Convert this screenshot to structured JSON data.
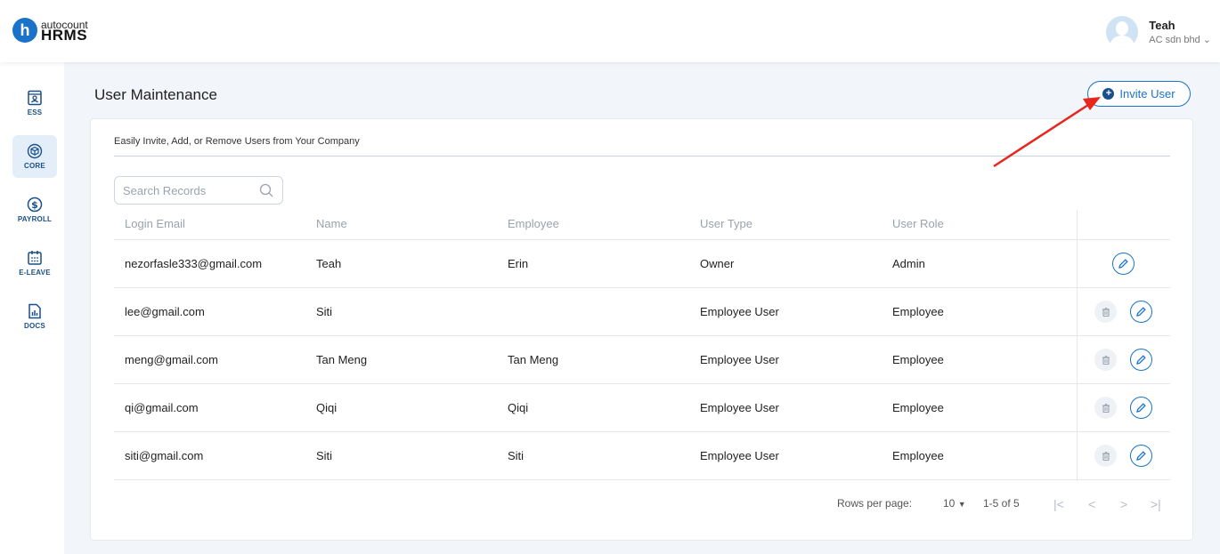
{
  "app": {
    "logo_letter": "h",
    "logo_small": "autocount",
    "logo_big": "HRMS"
  },
  "user": {
    "name": "Teah",
    "company": "AC sdn bhd ⌄"
  },
  "sidebar": {
    "items": [
      {
        "label": "ESS",
        "icon": "ess-icon"
      },
      {
        "label": "CORE",
        "icon": "cube-icon",
        "active": true
      },
      {
        "label": "PAYROLL",
        "icon": "dollar-icon"
      },
      {
        "label": "E-LEAVE",
        "icon": "calendar-icon"
      },
      {
        "label": "DOCS",
        "icon": "document-chart-icon"
      }
    ]
  },
  "page": {
    "title": "User Maintenance",
    "invite_label": "Invite User",
    "description": "Easily Invite, Add, or Remove Users from Your Company"
  },
  "search": {
    "placeholder": "Search Records"
  },
  "table": {
    "headers": [
      "Login Email",
      "Name",
      "Employee",
      "User Type",
      "User Role"
    ],
    "rows": [
      {
        "email": "nezorfasle333@gmail.com",
        "name": "Teah",
        "employee": "Erin",
        "type": "Owner",
        "role": "Admin",
        "deletable": false
      },
      {
        "email": "lee@gmail.com",
        "name": "Siti",
        "employee": "",
        "type": "Employee User",
        "role": "Employee",
        "deletable": true
      },
      {
        "email": "meng@gmail.com",
        "name": "Tan Meng",
        "employee": "Tan Meng",
        "type": "Employee User",
        "role": "Employee",
        "deletable": true
      },
      {
        "email": "qi@gmail.com",
        "name": "Qiqi",
        "employee": "Qiqi",
        "type": "Employee User",
        "role": "Employee",
        "deletable": true
      },
      {
        "email": "siti@gmail.com",
        "name": "Siti",
        "employee": "Siti",
        "type": "Employee User",
        "role": "Employee",
        "deletable": true
      }
    ]
  },
  "pagination": {
    "rows_label": "Rows per page:",
    "rows_value": "10",
    "range": "1-5 of 5",
    "first": "|<",
    "prev": "<",
    "next": ">",
    "last": ">|"
  },
  "colors": {
    "accent": "#1a73c9",
    "arrow": "#e8261e"
  }
}
